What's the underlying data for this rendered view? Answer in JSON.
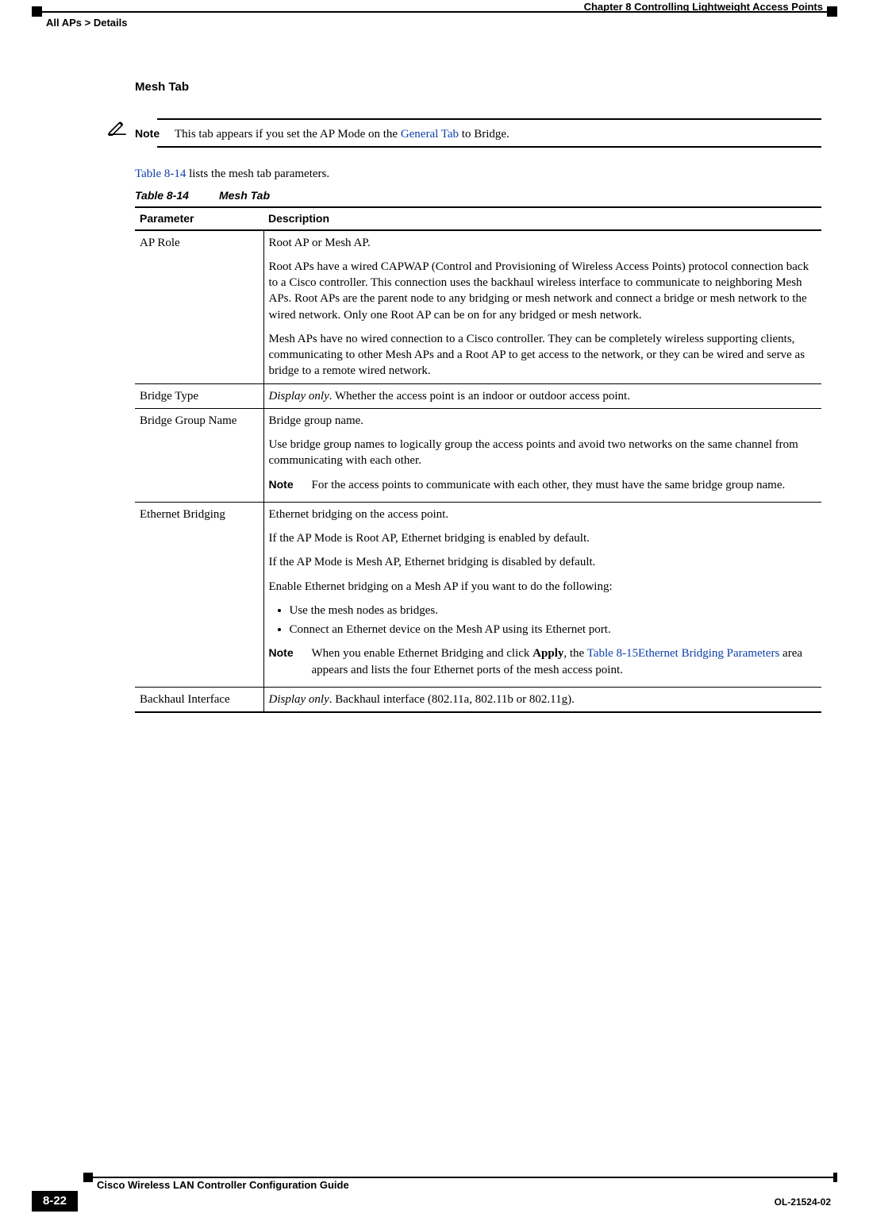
{
  "header": {
    "chapter_line": "Chapter 8      Controlling Lightweight Access Points",
    "breadcrumb": "All APs > Details"
  },
  "section_title": "Mesh Tab",
  "note": {
    "label": "Note",
    "prefix": "This tab appears if you set the AP Mode on the ",
    "link": "General Tab",
    "suffix": " to Bridge."
  },
  "intro": {
    "link": "Table 8-14",
    "rest": " lists the mesh tab parameters."
  },
  "table_caption": {
    "num": "Table 8-14",
    "title": "Mesh Tab"
  },
  "column_headers": {
    "param": "Parameter",
    "desc": "Description"
  },
  "rows": {
    "ap_role": {
      "param": "AP Role",
      "p1": "Root AP or Mesh AP.",
      "p2": "Root APs have a wired CAPWAP (Control and Provisioning of Wireless Access Points) protocol connection back to a Cisco controller. This connection uses the backhaul wireless interface to communicate to neighboring Mesh APs. Root APs are the parent node to any bridging or mesh network and connect a bridge or mesh network to the wired network. Only one Root AP can be on for any bridged or mesh network.",
      "p3": "Mesh APs have no wired connection to a Cisco controller. They can be completely wireless supporting clients, communicating to other Mesh APs and a Root AP to get access to the network, or they can be wired and serve as bridge to a remote wired network."
    },
    "bridge_type": {
      "param": "Bridge Type",
      "emph": "Display only",
      "rest": ". Whether the access point is an indoor or outdoor access point."
    },
    "bridge_group_name": {
      "param": "Bridge Group Name",
      "p1": "Bridge group name.",
      "p2": "Use bridge group names to logically group the access points and avoid two networks on the same channel from communicating with each other.",
      "note_label": "Note",
      "note_text": "For the access points to communicate with each other, they must have the same bridge group name."
    },
    "ethernet_bridging": {
      "param": "Ethernet Bridging",
      "p1": "Ethernet bridging on the access point.",
      "p2": "If the AP Mode is Root AP, Ethernet bridging is enabled by default.",
      "p3": "If the AP Mode is Mesh AP, Ethernet bridging is disabled by default.",
      "p4": "Enable Ethernet bridging on a Mesh AP if you want to do the following:",
      "b1": "Use the mesh nodes as bridges.",
      "b2": "Connect an Ethernet device on the Mesh AP using its Ethernet port.",
      "note_label": "Note",
      "note_pre": "When you enable Ethernet Bridging and click ",
      "note_apply": "Apply",
      "note_mid": ", the ",
      "note_link": "Table 8-15Ethernet Bridging Parameters",
      "note_post": " area appears and lists the four Ethernet ports of the mesh access point."
    },
    "backhaul": {
      "param": "Backhaul Interface",
      "emph": "Display only",
      "rest": ". Backhaul interface (802.11a, 802.11b or 802.11g)."
    }
  },
  "footer": {
    "guide_title": "Cisco Wireless LAN Controller Configuration Guide",
    "page_number": "8-22",
    "doc_number": "OL-21524-02"
  }
}
